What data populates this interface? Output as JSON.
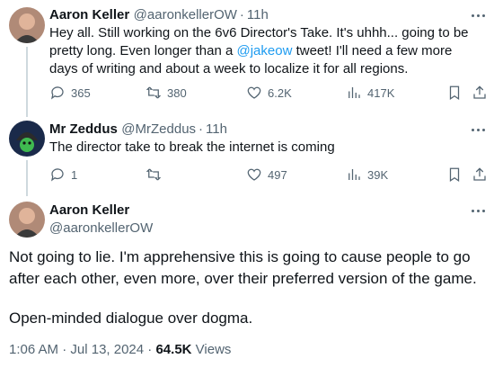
{
  "tweet1": {
    "name": "Aaron Keller",
    "handle": "@aaronkellerOW",
    "time": "11h",
    "text_before": "Hey all. Still working on the 6v6 Director's Take. It's uhhh... going to be pretty long. Even longer than a ",
    "mention": "@jakeow",
    "text_after": " tweet! I'll need a few more days of writing and about a week to localize it for all regions.",
    "replies": "365",
    "retweets": "380",
    "likes": "6.2K",
    "views": "417K"
  },
  "tweet2": {
    "name": "Mr Zeddus",
    "handle": "@MrZeddus",
    "time": "11h",
    "text": "The director take to break the internet is coming",
    "replies": "1",
    "retweets": "",
    "likes": "497",
    "views": "39K"
  },
  "main_tweet": {
    "name": "Aaron Keller",
    "handle": "@aaronkellerOW",
    "paragraph1": "Not going to lie. I'm apprehensive this is going to cause people to go after each other, even more, over their preferred version of the game.",
    "paragraph2": "Open-minded dialogue over dogma.",
    "time": "1:06 AM",
    "date": "Jul 13, 2024",
    "views_count": "64.5K",
    "views_label": "Views"
  },
  "colors": {
    "accent": "#1d9bf0",
    "secondary_text": "#536471",
    "primary_text": "#0f1419"
  }
}
